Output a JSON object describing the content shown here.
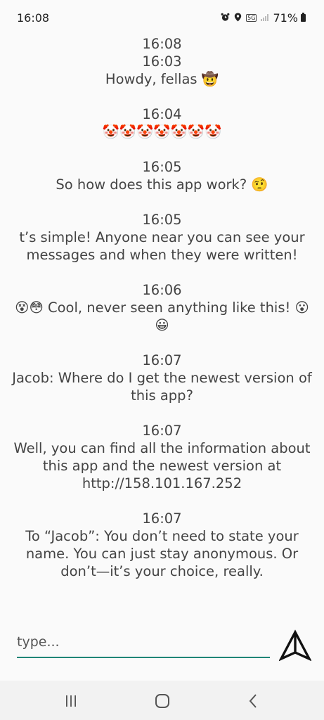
{
  "status_bar": {
    "time": "16:08",
    "network": "5G",
    "battery": "71%",
    "icons": [
      "alarm-icon",
      "location-icon",
      "network-5g-icon",
      "signal-icon",
      "battery-icon"
    ]
  },
  "feed": {
    "header_time": "16:08",
    "messages": [
      {
        "time": "16:03",
        "text": "Howdy, fellas 🤠"
      },
      {
        "time": "16:04",
        "text": "🤡🤡🤡🤡🤡🤡🤡"
      },
      {
        "time": "16:05",
        "text": "So how does this app work? 🤨"
      },
      {
        "time": "16:05",
        "text": "t’s simple! Anyone near you can see your messages and when they were written!"
      },
      {
        "time": "16:06",
        "text": "😵😳 Cool, never seen anything like this! 😮 😀"
      },
      {
        "time": "16:07",
        "text": "Jacob: Where do I get the newest version of this app?"
      },
      {
        "time": "16:07",
        "text": "Well, you can find all the information about this app and the newest version at http://158.101.167.252"
      },
      {
        "time": "16:07",
        "text": "To “Jacob”: You don’t need to state your name. You can just stay anonymous. Or don’t—it’s your choice, really."
      }
    ]
  },
  "composer": {
    "placeholder": "type...",
    "value": "",
    "accent_color": "#1f8577",
    "send_icon": "send-arrow-icon"
  },
  "nav_bar": {
    "icons": [
      "recent-apps-icon",
      "home-icon",
      "back-icon"
    ]
  }
}
